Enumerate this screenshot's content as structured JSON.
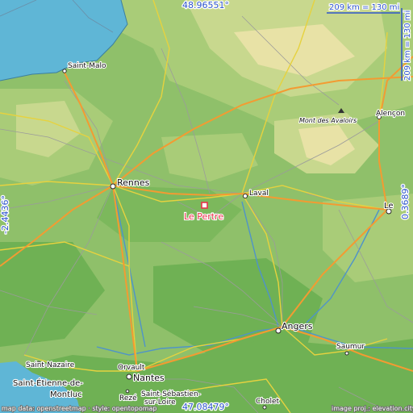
{
  "coordinates": {
    "north": "48.96551°",
    "south": "47.08479°",
    "west": "-2.4436°",
    "east": "0.3689°"
  },
  "scale_labels": {
    "horizontal": "209 km = 130 mi",
    "vertical": "209 km = 130 mi"
  },
  "highlight_place": "Le Pertre",
  "places": {
    "saint_malo": "Saint-Malo",
    "rennes": "Rennes",
    "laval": "Laval",
    "le_mans": "Le",
    "alencon": "Alençon",
    "mont_des_avaloirs": "Mont des Avaloirs",
    "angers": "Angers",
    "saumur": "Saumur",
    "saint_nazaire": "Saint-Nazaire",
    "saint_etienne_de_montluc_1": "Saint-Étienne-de-",
    "saint_etienne_de_montluc_2": "Montluc",
    "orvault": "Orvault",
    "nantes": "Nantes",
    "reze": "Rezé",
    "saint_sebastien_1": "Saint-Sébastien-",
    "saint_sebastien_2": "sur-Loire",
    "cholet": "Cholet"
  },
  "attribution": {
    "left": "map data: openstreetmap · style: opentopomap",
    "right": "image proj.: elevation.city"
  },
  "colors": {
    "sea": "#5fb6d6",
    "lowland": "#6fb154",
    "plain": "#8fc06a",
    "hill": "#c8d88e",
    "upland": "#e8e2a6",
    "primary_road": "#f39b32",
    "secondary_road": "#e6d23f",
    "highlight": "#e8334a",
    "coordinate_text": "#2e55cc"
  }
}
